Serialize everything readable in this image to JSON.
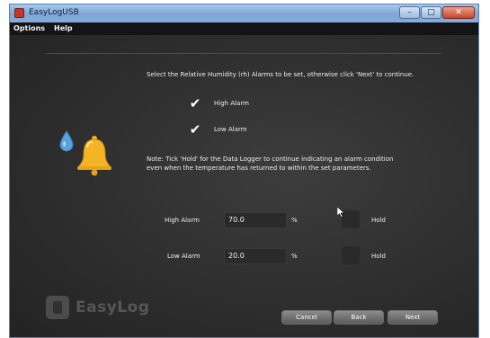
{
  "window": {
    "title": "EasyLogUSB"
  },
  "menu": {
    "items": [
      {
        "label": "Options"
      },
      {
        "label": "Help"
      }
    ]
  },
  "main": {
    "instruction": "Select the Relative Humidity (rh) Alarms to be set, otherwise click 'Next' to continue.",
    "checks": [
      {
        "label": "High Alarm",
        "checked": true
      },
      {
        "label": "Low Alarm",
        "checked": true
      }
    ],
    "note_line1": "Note: Tick 'Hold' for the Data Logger to continue indicating an alarm condition",
    "note_line2": "even when the temperature has returned to within the set parameters.",
    "alarms": [
      {
        "label": "High Alarm",
        "value": "70.0",
        "unit": "%",
        "hold_label": "Hold"
      },
      {
        "label": "Low Alarm",
        "value": "20.0",
        "unit": "%",
        "hold_label": "Hold"
      }
    ]
  },
  "logo": {
    "text": "EasyLog"
  },
  "buttons": {
    "cancel": "Cancel",
    "back": "Back",
    "next": "Next"
  },
  "colors": {
    "bell": "#f3b425",
    "drop": "#5aa0dc",
    "background": "#2e2e2e"
  },
  "icons": {
    "bell": "bell-icon",
    "drop": "water-drop-icon",
    "check": "checkmark-icon"
  }
}
